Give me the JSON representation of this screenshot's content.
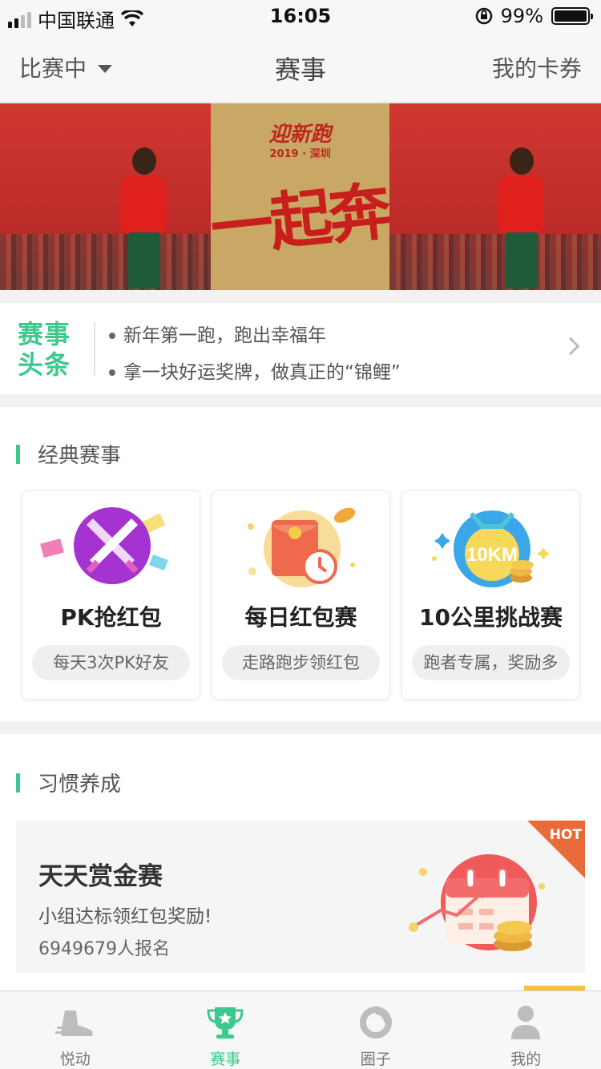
{
  "status_bar": {
    "carrier": "中国联通",
    "time": "16:05",
    "battery": "99%",
    "battery_level": 0.99,
    "signal_bars_filled": 2
  },
  "nav": {
    "filter_label": "比赛中",
    "title": "赛事",
    "coupons_label": "我的卡券"
  },
  "banner": {
    "logo_text": "迎新跑",
    "year_text": "2019 · 深圳",
    "slogan": "一起奔!"
  },
  "headlines": {
    "logo_line1": "赛事",
    "logo_line2": "头条",
    "items": [
      "新年第一跑，跑出幸福年",
      "拿一块好运奖牌，做真正的“锦鲤”"
    ]
  },
  "classic": {
    "heading": "经典赛事",
    "cards": [
      {
        "title": "PK抢红包",
        "subtitle": "每天3次PK好友",
        "icon": "crossed-swords-icon"
      },
      {
        "title": "每日红包赛",
        "subtitle": "走路跑步领红包",
        "icon": "red-envelope-icon"
      },
      {
        "title": "10公里挑战赛",
        "subtitle": "跑者专属，奖励多",
        "icon": "medal-10km-icon",
        "badge": "10KM"
      }
    ]
  },
  "habit": {
    "heading": "习惯养成",
    "card": {
      "title": "天天赏金赛",
      "description": "小组达标领红包奖励!",
      "count": "6949679人报名",
      "hot_badge": "HOT",
      "icon": "calendar-coins-icon"
    }
  },
  "tabbar": {
    "items": [
      {
        "label": "悦动",
        "icon": "shoe-icon"
      },
      {
        "label": "赛事",
        "icon": "trophy-icon",
        "active": true
      },
      {
        "label": "圈子",
        "icon": "circle-icon"
      },
      {
        "label": "我的",
        "icon": "person-icon"
      }
    ]
  },
  "colors": {
    "accent": "#3cc98d",
    "banner_red": "#c8302c",
    "banner_gold": "#c9a865",
    "hot": "#e86a38"
  }
}
